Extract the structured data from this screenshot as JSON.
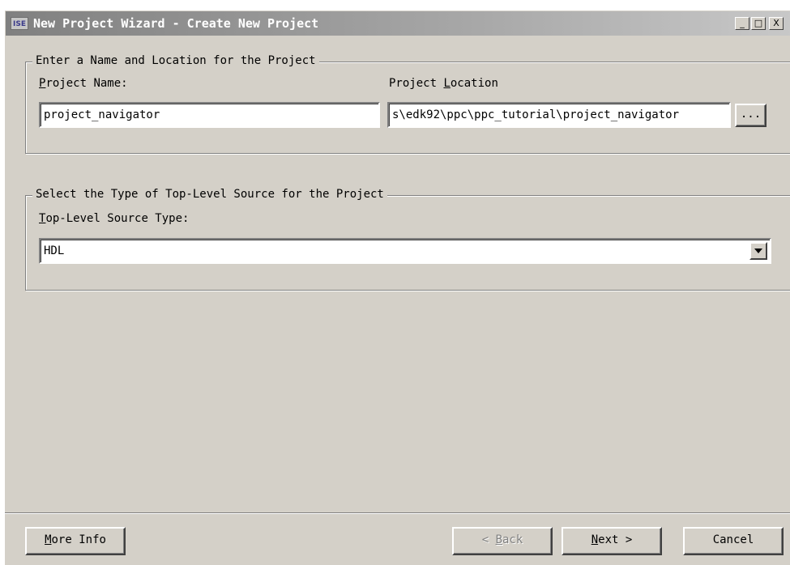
{
  "window": {
    "icon_text": "ISE",
    "title": "New Project Wizard - Create New Project",
    "controls": {
      "minimize": "_",
      "maximize": "□",
      "close": "X"
    }
  },
  "location_group": {
    "legend": "Enter a Name and Location for the Project",
    "name_label": {
      "mnemonic": "P",
      "rest": "roject Name:"
    },
    "name_value": "project_navigator",
    "location_label": {
      "before": "Project ",
      "mnemonic": "L",
      "after": "ocation"
    },
    "location_value": "s\\edk92\\ppc\\ppc_tutorial\\project_navigator",
    "browse_label": "..."
  },
  "source_group": {
    "legend": "Select the Type of Top-Level Source for the Project",
    "type_label": {
      "mnemonic": "T",
      "rest": "op-Level Source Type:"
    },
    "type_value": "HDL"
  },
  "buttons": {
    "more_info": {
      "mnemonic": "M",
      "rest": "ore Info"
    },
    "back": {
      "prefix": "< ",
      "mnemonic": "B",
      "rest": "ack"
    },
    "next": {
      "mnemonic": "N",
      "rest": "ext >"
    },
    "cancel": "Cancel"
  }
}
